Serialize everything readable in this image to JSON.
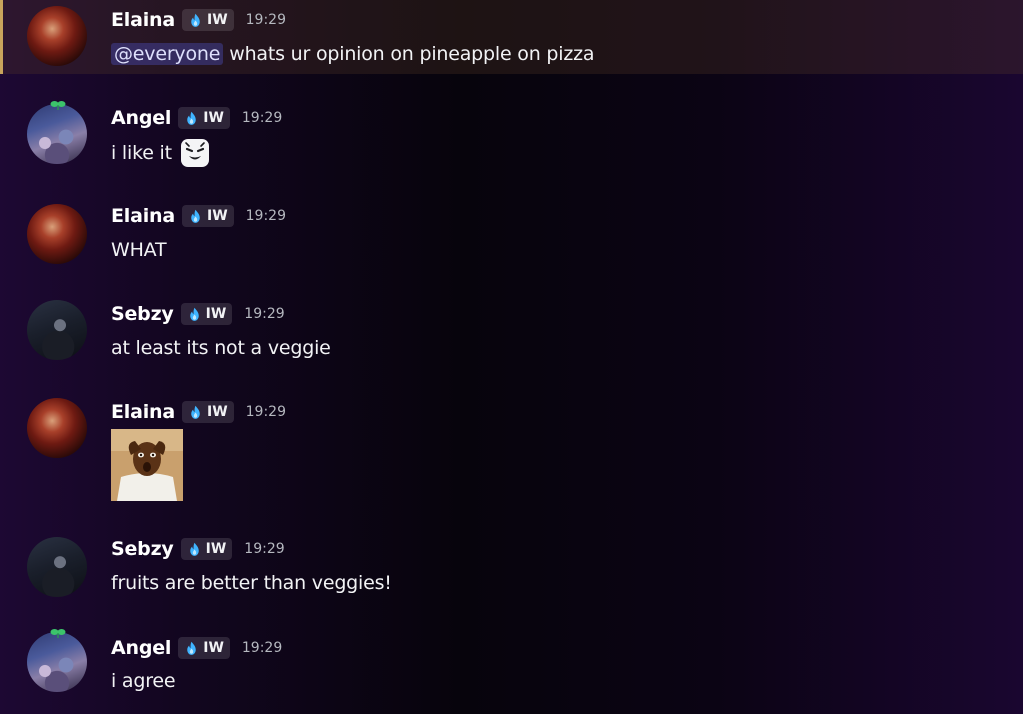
{
  "messages": [
    {
      "author": "Elaina",
      "tag": "IW",
      "time": "19:29",
      "mention": "@everyone",
      "text": "whats ur opinion on pineapple on pizza"
    },
    {
      "author": "Angel",
      "tag": "IW",
      "time": "19:29",
      "text": "i like it",
      "emoji": "smirking-face-emoji"
    },
    {
      "author": "Elaina",
      "tag": "IW",
      "time": "19:29",
      "text": "WHAT"
    },
    {
      "author": "Sebzy",
      "tag": "IW",
      "time": "19:29",
      "text": "at least its not a veggie"
    },
    {
      "author": "Elaina",
      "tag": "IW",
      "time": "19:29",
      "attachment": "shocked-man-sticker"
    },
    {
      "author": "Sebzy",
      "tag": "IW",
      "time": "19:29",
      "text": "fruits are better than veggies!"
    },
    {
      "author": "Angel",
      "tag": "IW",
      "time": "19:29",
      "text": "i agree"
    }
  ],
  "colors": {
    "mention_bar": "#c9a45c",
    "mention_pill": "#5865f2",
    "tag_icon": "#3fb4ff",
    "timestamp": "#b5b8bf"
  }
}
